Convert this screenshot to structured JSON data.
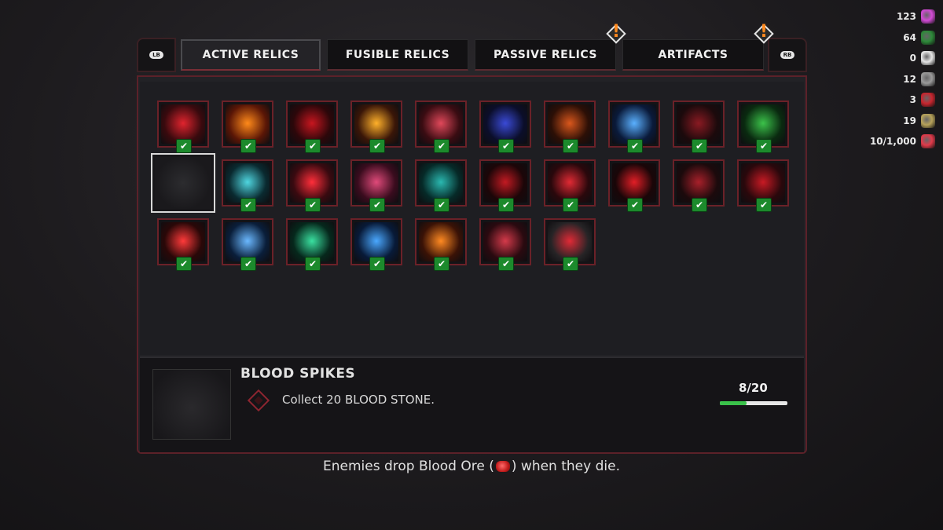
{
  "currencies": [
    {
      "value": "123",
      "icon": "pink-crystal-icon",
      "color": "#d24bd6"
    },
    {
      "value": "64",
      "icon": "green-gem-icon",
      "color": "#2e8a3a"
    },
    {
      "value": "0",
      "icon": "dice-icon",
      "color": "#e6e6e6"
    },
    {
      "value": "12",
      "icon": "grey-orb-icon",
      "color": "#9a9a9a"
    },
    {
      "value": "3",
      "icon": "red-x-icon",
      "color": "#c8252e"
    },
    {
      "value": "19",
      "icon": "cog-gold-icon",
      "color": "#b7a25a"
    },
    {
      "value": "10/1,000",
      "icon": "blood-ore-icon",
      "color": "#e23a4a"
    }
  ],
  "tabs": {
    "left_bumper": "LB",
    "right_bumper": "RB",
    "items": [
      {
        "label": "ACTIVE RELICS",
        "active": true,
        "alert": false
      },
      {
        "label": "FUSIBLE RELICS",
        "active": false,
        "alert": false
      },
      {
        "label": "PASSIVE RELICS",
        "active": false,
        "alert": true
      },
      {
        "label": "ARTIFACTS",
        "active": false,
        "alert": true
      }
    ],
    "alert_mark": "!"
  },
  "relics": [
    {
      "icon": "red-blade-slash-icon",
      "colors": [
        "#e0242e",
        "#3a0a0e"
      ],
      "unlocked": true
    },
    {
      "icon": "fire-burst-icon",
      "colors": [
        "#ff8a1a",
        "#5a1606"
      ],
      "unlocked": true
    },
    {
      "icon": "red-vortex-icon",
      "colors": [
        "#c7161f",
        "#2d070a"
      ],
      "unlocked": true
    },
    {
      "icon": "fire-crescent-icon",
      "colors": [
        "#ffb12a",
        "#3a1608"
      ],
      "unlocked": true
    },
    {
      "icon": "blood-beast-icon",
      "colors": [
        "#e0485a",
        "#3a0c12"
      ],
      "unlocked": true
    },
    {
      "icon": "dark-ring-icon",
      "colors": [
        "#3a4ad6",
        "#0b0e2a"
      ],
      "unlocked": true
    },
    {
      "icon": "flaming-wolf-icon",
      "colors": [
        "#d9571c",
        "#2c0f06"
      ],
      "unlocked": true
    },
    {
      "icon": "ice-sword-icon",
      "colors": [
        "#5ab0ff",
        "#0a1a3a"
      ],
      "unlocked": true
    },
    {
      "icon": "crimson-demon-icon",
      "colors": [
        "#8a1a22",
        "#1c0a0c"
      ],
      "unlocked": true
    },
    {
      "icon": "green-beast-icon",
      "colors": [
        "#3bc24a",
        "#0a2a10"
      ],
      "unlocked": true
    },
    {
      "icon": "empty-slot-icon",
      "colors": [
        "#2a292c",
        "#1a191c"
      ],
      "unlocked": false,
      "selected": true
    },
    {
      "icon": "ice-spirit-icon",
      "colors": [
        "#4fd6e0",
        "#0a2a30"
      ],
      "unlocked": true
    },
    {
      "icon": "red-lightning-icon",
      "colors": [
        "#ff2e3a",
        "#3a0a10"
      ],
      "unlocked": true
    },
    {
      "icon": "blood-flower-icon",
      "colors": [
        "#e04a7a",
        "#3a0c1e"
      ],
      "unlocked": true
    },
    {
      "icon": "teal-shield-icon",
      "colors": [
        "#2ab8b0",
        "#062a28"
      ],
      "unlocked": true
    },
    {
      "icon": "hooded-figure-icon",
      "colors": [
        "#c21a22",
        "#1c0608"
      ],
      "unlocked": true
    },
    {
      "icon": "blood-whip-icon",
      "colors": [
        "#e02a34",
        "#2a080c"
      ],
      "unlocked": true
    },
    {
      "icon": "red-crescent-icon",
      "colors": [
        "#e21e26",
        "#1a0608"
      ],
      "unlocked": true
    },
    {
      "icon": "dark-axe-icon",
      "colors": [
        "#a8202a",
        "#1c0a0c"
      ],
      "unlocked": true
    },
    {
      "icon": "crimson-scythe-icon",
      "colors": [
        "#c81a24",
        "#2a080c"
      ],
      "unlocked": true
    },
    {
      "icon": "red-claw-slash-icon",
      "colors": [
        "#ff3a3a",
        "#2a0808"
      ],
      "unlocked": true
    },
    {
      "icon": "ice-shard-icon",
      "colors": [
        "#6ab8ff",
        "#0a1e3a"
      ],
      "unlocked": true
    },
    {
      "icon": "green-spirit-icon",
      "colors": [
        "#3ae0a0",
        "#06281c"
      ],
      "unlocked": true
    },
    {
      "icon": "blue-bolt-icon",
      "colors": [
        "#4aa8ff",
        "#081a38"
      ],
      "unlocked": true
    },
    {
      "icon": "flaming-skull-icon",
      "colors": [
        "#ff8a22",
        "#3a1206"
      ],
      "unlocked": true
    },
    {
      "icon": "blood-tree-icon",
      "colors": [
        "#d43a4a",
        "#2a0a10"
      ],
      "unlocked": true
    },
    {
      "icon": "red-eye-beam-icon",
      "colors": [
        "#e02a36",
        "#262426"
      ],
      "unlocked": true
    }
  ],
  "selected_relic": {
    "title": "BLOOD SPIKES",
    "quest": "Collect 20 BLOOD STONE.",
    "progress_text": "8/20",
    "progress": 0.4
  },
  "hint": {
    "before": "Enemies drop Blood Ore (",
    "after": ") when they die."
  },
  "check_mark": "✔"
}
